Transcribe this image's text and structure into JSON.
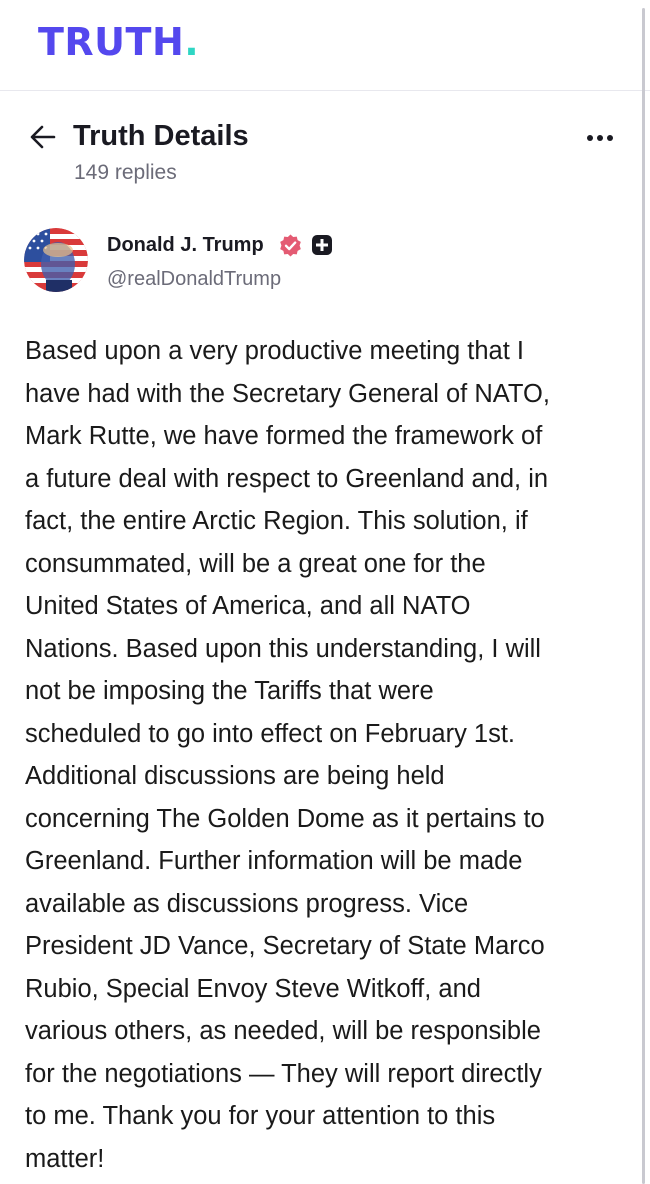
{
  "app": {
    "logo_text": "TRUTH",
    "logo_dot": ".",
    "brand_color": "#5448ee",
    "accent_color": "#2fd6c4"
  },
  "header": {
    "title": "Truth Details",
    "replies": "149 replies",
    "back_icon": "arrow-left-icon",
    "more_icon": "more-horizontal-icon"
  },
  "author": {
    "name": "Donald J. Trump",
    "handle": "@realDonaldTrump",
    "verified_icon": "verified-badge-icon",
    "verified_color": "#e45b73",
    "plus_icon": "truth-plus-icon"
  },
  "post": {
    "lines": [
      "Based upon a very productive meeting that I",
      "have had with the Secretary General of NATO,",
      "Mark Rutte, we have formed the framework of",
      "a future deal with respect to Greenland and, in",
      "fact, the entire Arctic Region. This solution, if",
      "consummated, will be a great one for the",
      "United States of America, and all NATO",
      "Nations. Based upon this understanding, I will",
      "not be imposing the Tariffs that were",
      "scheduled to go into effect on February 1st.",
      "Additional discussions are being held",
      "concerning The Golden Dome as it pertains to",
      "Greenland. Further information will be made",
      "available as discussions progress. Vice",
      "President JD Vance, Secretary of State Marco",
      "Rubio, Special Envoy Steve Witkoff, and",
      "various others, as needed, will be responsible",
      "for the negotiations — They will report directly",
      "to me. Thank you for your attention to this",
      "matter!"
    ]
  }
}
